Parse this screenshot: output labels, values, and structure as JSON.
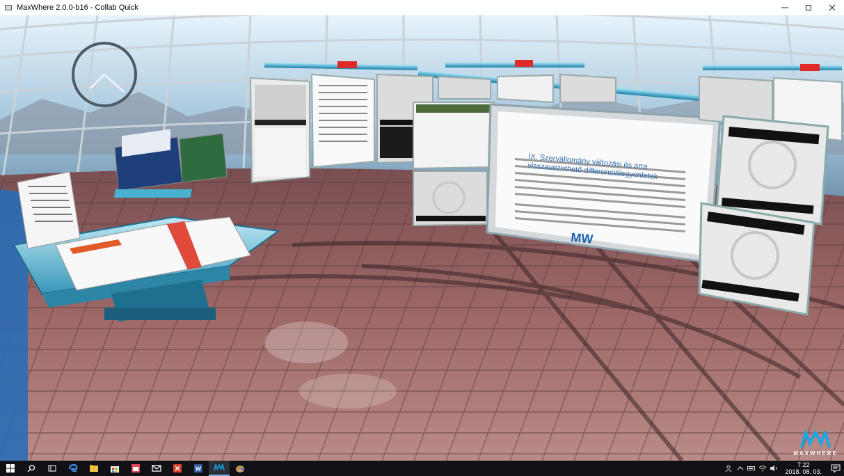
{
  "window": {
    "title": "MaxWhere 2.0.0-b16 - Collab Quick",
    "controls": [
      "minimize",
      "maximize",
      "close"
    ]
  },
  "scene": {
    "document_heading": "IX. Szervállomány változási és arra visszavezethető differenciálegyenletek",
    "brand_name": "MAXWHERE"
  },
  "taskbar": {
    "items": [
      {
        "icon": "windows-start-icon"
      },
      {
        "icon": "search-icon"
      },
      {
        "icon": "task-view-icon"
      },
      {
        "icon": "edge-browser-icon"
      },
      {
        "icon": "file-explorer-icon"
      },
      {
        "icon": "store-icon"
      },
      {
        "icon": "calendar-app-icon"
      },
      {
        "icon": "mail-icon"
      },
      {
        "icon": "red-app-icon"
      },
      {
        "icon": "word-icon"
      },
      {
        "icon": "maxwhere-icon"
      },
      {
        "icon": "paint-icon"
      }
    ],
    "clock_time": "7:22",
    "clock_date": "2018. 08. 03."
  }
}
